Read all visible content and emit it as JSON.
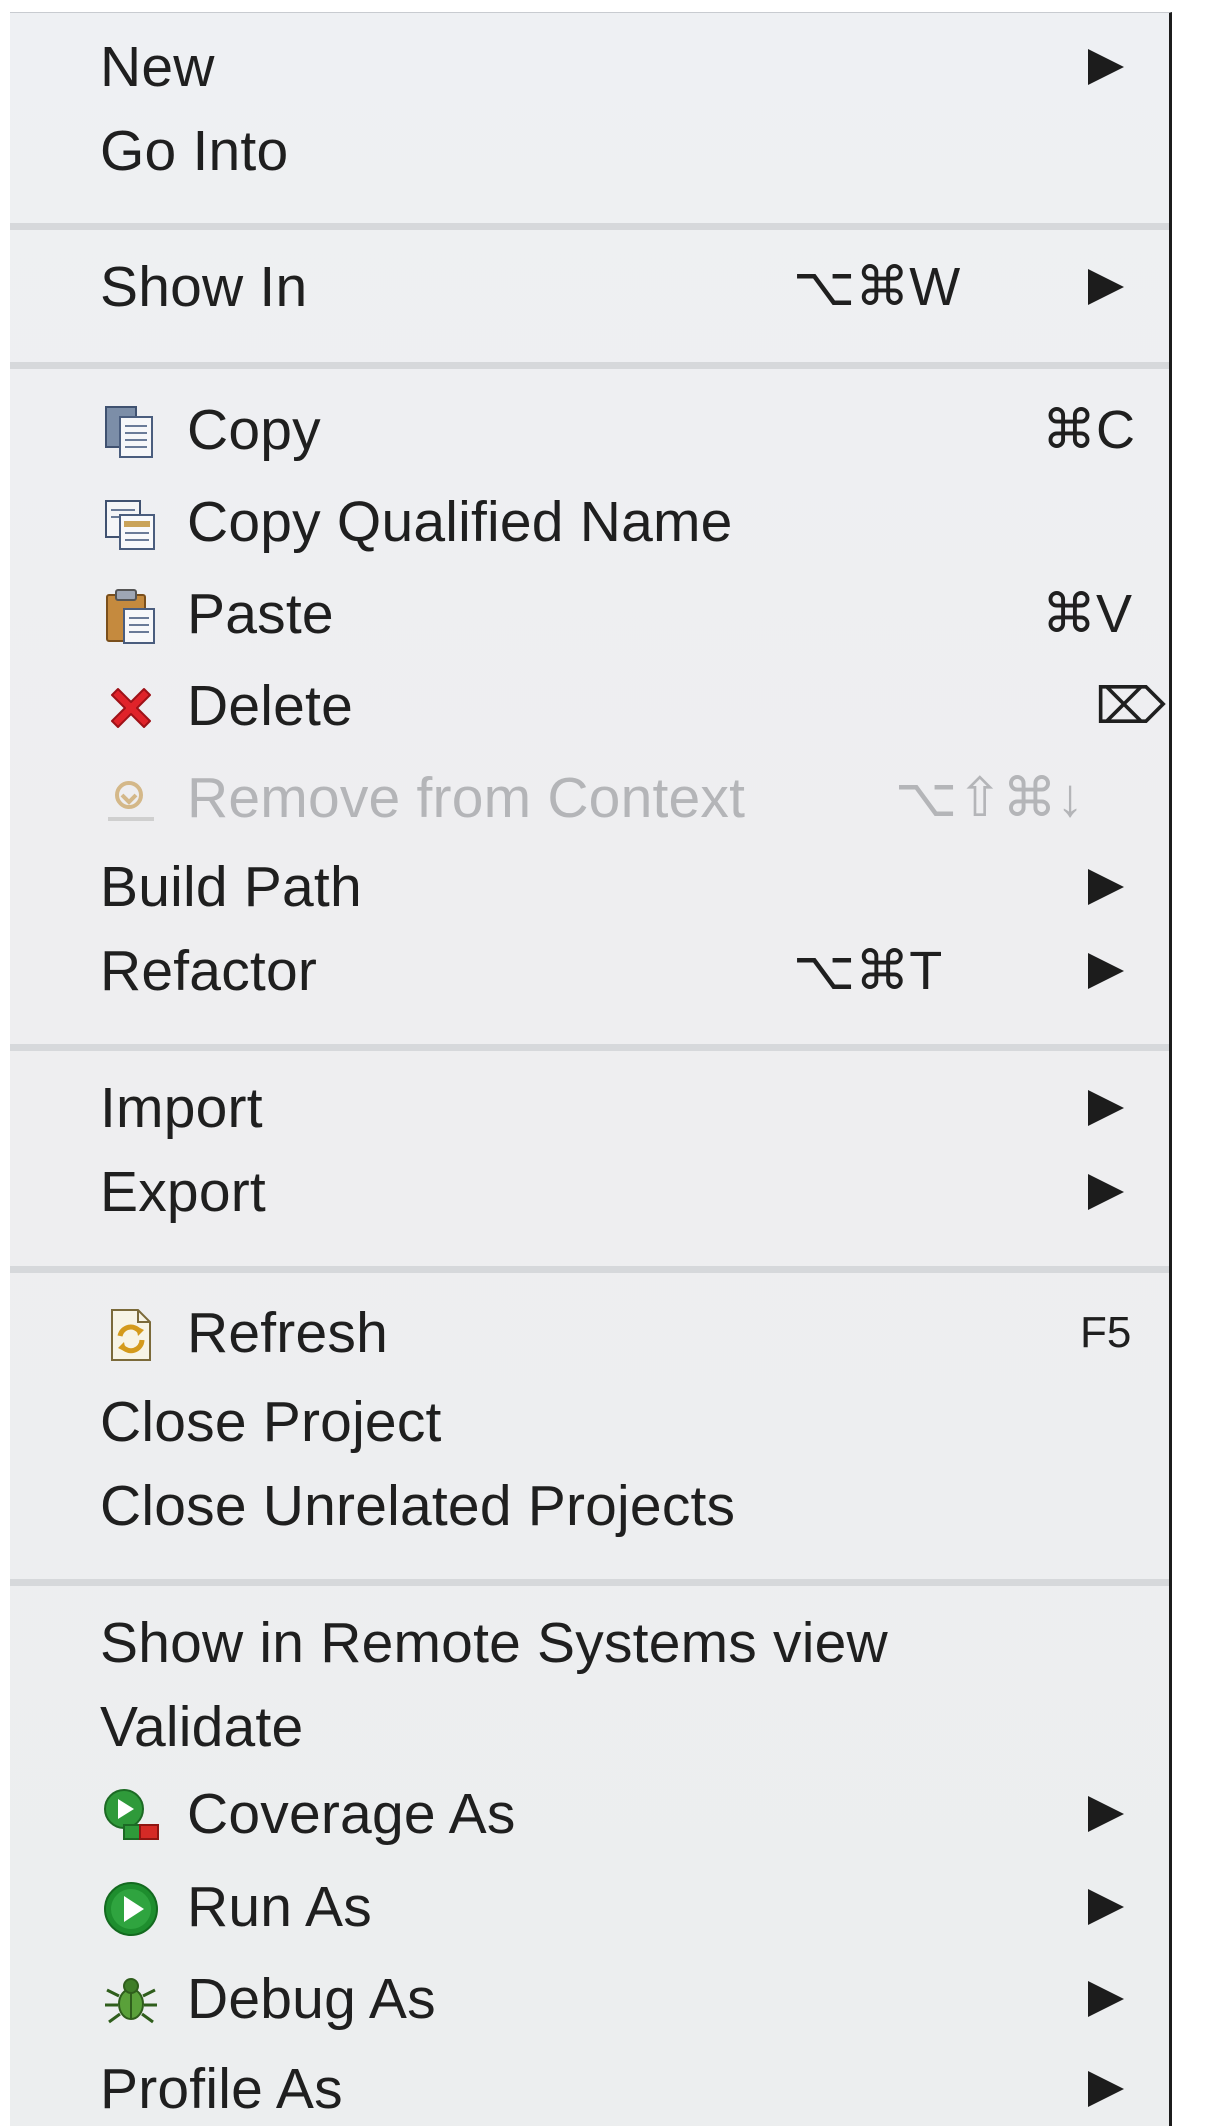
{
  "menu": {
    "items": [
      {
        "label": "New"
      },
      {
        "label": "Go Into"
      },
      {
        "label": "Show In",
        "shortcut": "⌥⌘W"
      },
      {
        "label": "Copy",
        "shortcut": "⌘C",
        "icon": "copy-icon"
      },
      {
        "label": "Copy Qualified Name",
        "icon": "copy-qualified-name-icon"
      },
      {
        "label": "Paste",
        "shortcut": "⌘V",
        "icon": "paste-icon"
      },
      {
        "label": "Delete",
        "shortcut": "⌦",
        "icon": "delete-icon"
      },
      {
        "label": "Remove from Context",
        "shortcut": "⌥⇧⌘↓",
        "icon": "remove-from-context-icon",
        "disabled": true
      },
      {
        "label": "Build Path"
      },
      {
        "label": "Refactor",
        "shortcut": "⌥⌘T"
      },
      {
        "label": "Import"
      },
      {
        "label": "Export"
      },
      {
        "label": "Refresh",
        "shortcut": "F5",
        "icon": "refresh-icon"
      },
      {
        "label": "Close Project"
      },
      {
        "label": "Close Unrelated Projects"
      },
      {
        "label": "Show in Remote Systems view"
      },
      {
        "label": "Validate"
      },
      {
        "label": "Coverage As",
        "icon": "coverage-icon"
      },
      {
        "label": "Run As",
        "icon": "run-icon"
      },
      {
        "label": "Debug As",
        "icon": "debug-icon"
      },
      {
        "label": "Profile As"
      }
    ]
  },
  "colors": {
    "text": "#1f1f1f",
    "disabled_text": "#b4b5b8",
    "separator": "#d6d8db",
    "menu_background": "#eeeff1",
    "delete_red": "#e0232a",
    "run_green": "#1e8e2e"
  }
}
